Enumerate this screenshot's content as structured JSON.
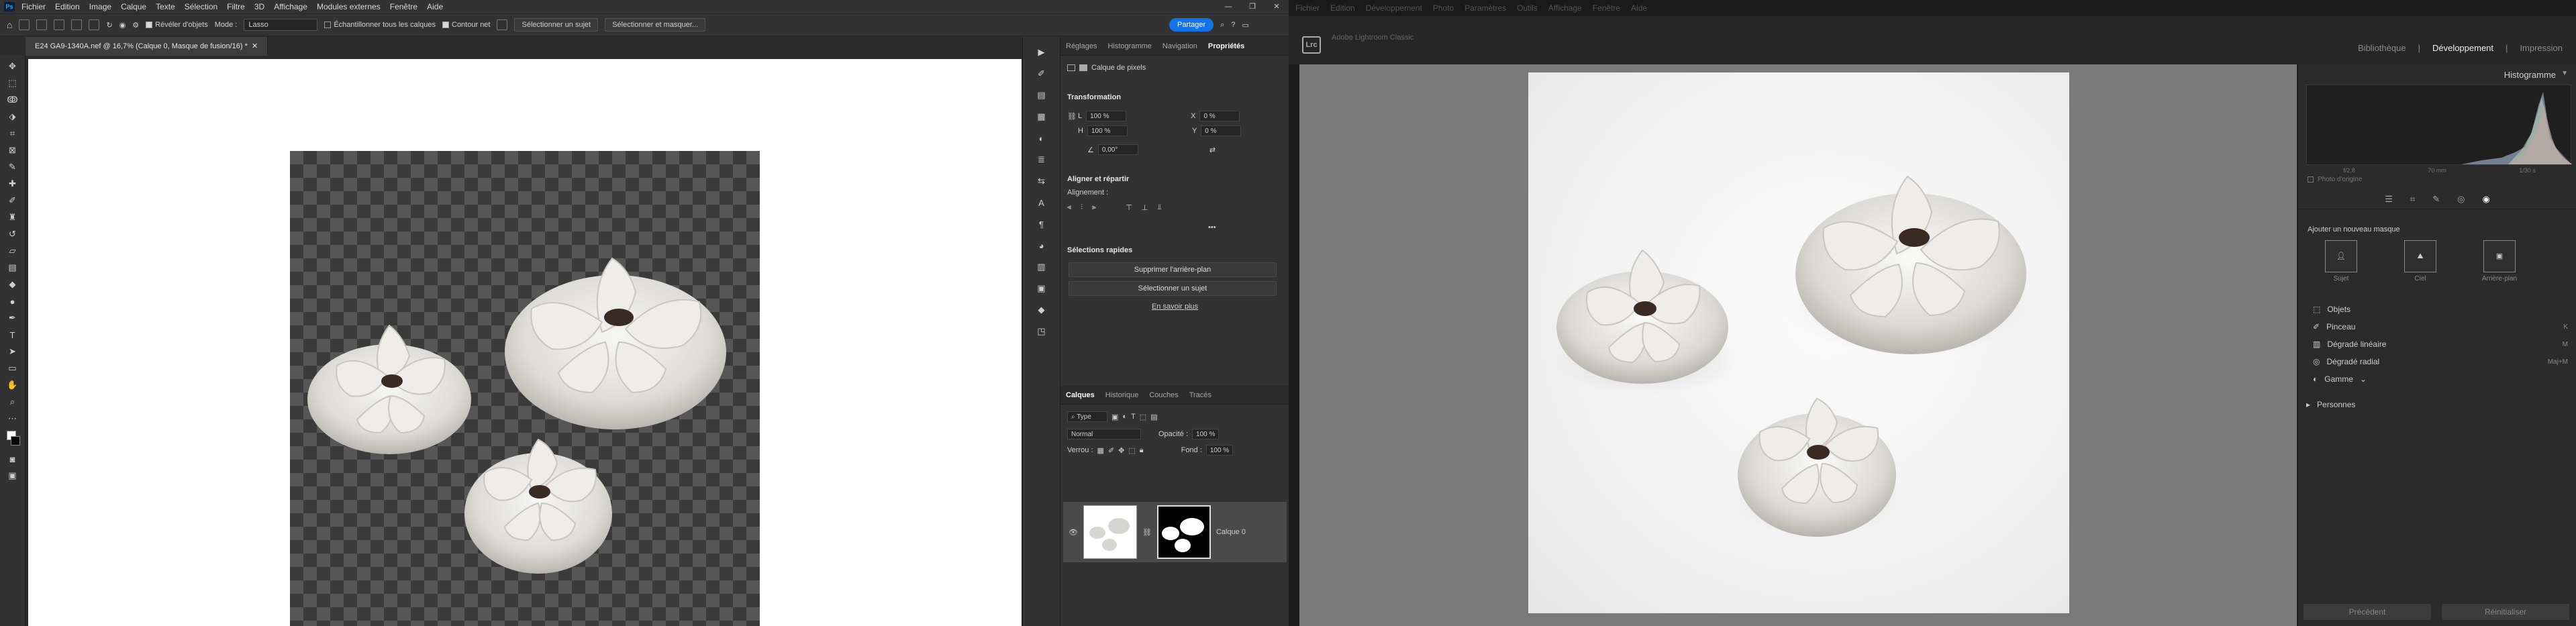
{
  "ps": {
    "logo": "Ps",
    "menus": [
      "Fichier",
      "Edition",
      "Image",
      "Calque",
      "Texte",
      "Sélection",
      "Filtre",
      "3D",
      "Affichage",
      "Modules externes",
      "Fenêtre",
      "Aide"
    ],
    "win": {
      "min": "—",
      "max": "❐",
      "close": "✕"
    },
    "options": {
      "reveal": "Révéler d'objets",
      "mode_label": "Mode :",
      "mode_value": "Lasso",
      "sample_all": "Échantillonner tous les calques",
      "hard_edge": "Contour net",
      "select_subject": "Sélectionner un sujet",
      "select_mask": "Sélectionner et masquer...",
      "share": "Partager"
    },
    "tab_title": "E24 GA9-1340A.nef @ 16,7% (Calque 0, Masque de fusion/16) *",
    "panel_tabs": [
      "Réglages",
      "Histogramme",
      "Navigation",
      "Propriétés"
    ],
    "props": {
      "layer_type": "Calque de pixels",
      "transform": "Transformation",
      "L_label": "L",
      "L_value": "100 %",
      "X_label": "X",
      "X_value": "0 %",
      "H_label": "H",
      "H_value": "100 %",
      "Y_label": "Y",
      "Y_value": "0 %",
      "angle": "0,00°",
      "align": "Aligner et répartir",
      "align_label": "Alignement :",
      "quick": "Sélections rapides",
      "remove_bg": "Supprimer l'arrière-plan",
      "select_subject": "Sélectionner un sujet",
      "learn_more": "En savoir plus"
    },
    "layer_tabs": [
      "Calques",
      "Historique",
      "Couches",
      "Tracés"
    ],
    "layers": {
      "filter": "Type",
      "blend": "Normal",
      "opacity_label": "Opacité :",
      "opacity": "100 %",
      "lock_label": "Verrou :",
      "fill_label": "Fond :",
      "fill": "100 %",
      "layer_name": "Calque 0"
    }
  },
  "lr": {
    "menus": [
      "Fichier",
      "Edition",
      "Développement",
      "Photo",
      "Paramètres",
      "Outils",
      "Affichage",
      "Fenêtre",
      "Aide"
    ],
    "logo": "Lrc",
    "catalog": "Adobe Lightroom Classic",
    "modules": [
      "Bibliothèque",
      "Développement",
      "Impression"
    ],
    "histogram_title": "Histogramme",
    "histo_labels": [
      "f/2,8",
      "70 mm",
      "1/30 s"
    ],
    "original_photo": "Photo d'origine",
    "add_mask": "Ajouter un nouveau masque",
    "mask_types": [
      "Sujet",
      "Ciel",
      "Arrière-plan"
    ],
    "tools": [
      {
        "label": "Objets",
        "shortcut": ""
      },
      {
        "label": "Pinceau",
        "shortcut": "K"
      },
      {
        "label": "Dégradé linéaire",
        "shortcut": "M"
      },
      {
        "label": "Dégradé radial",
        "shortcut": "Maj+M"
      },
      {
        "label": "Gamme",
        "shortcut": ""
      }
    ],
    "people": "Personnes",
    "prev_btn": "Précédent",
    "reset_btn": "Réinitialiser"
  }
}
